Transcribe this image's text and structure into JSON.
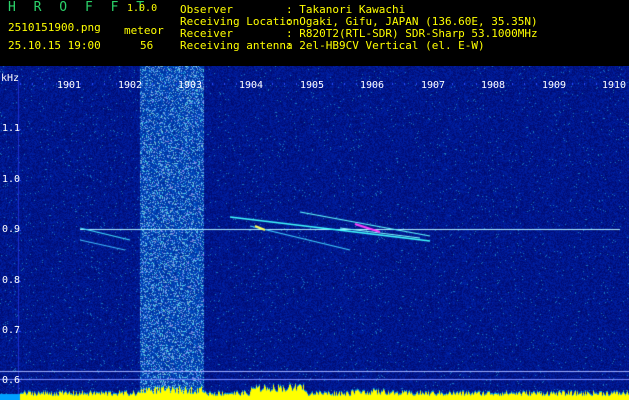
{
  "app": {
    "title": "H R O F F T",
    "version": "1.0.0"
  },
  "file": {
    "name": "2510151900.png",
    "timestamp": "25.10.15 19:00"
  },
  "meteor": {
    "label": "meteor",
    "count": "56"
  },
  "info": [
    {
      "label": "Observer",
      "value": ": Takanori Kawachi"
    },
    {
      "label": "Receiving Location",
      "value": ": Ogaki, Gifu, JAPAN (136.60E, 35.35N)"
    },
    {
      "label": "Receiver",
      "value": ": R820T2(RTL-SDR) SDR-Sharp 53.1000MHz"
    },
    {
      "label": "Receiving antenna",
      "value": ": 2el-HB9CV Vertical (el. E-W)"
    }
  ],
  "axis": {
    "unit": "kHz",
    "x_ticks": [
      "1901",
      "1902",
      "1903",
      "1904",
      "1905",
      "1906",
      "1907",
      "1908",
      "1909",
      "1910"
    ],
    "y_ticks": [
      "1.1",
      "1.0",
      "0.9",
      "0.8",
      "0.7",
      "0.6"
    ]
  },
  "colors": {
    "background": "#06067a",
    "signal": "#00ffff",
    "power": "#ffff00",
    "grid": "#1e3cff"
  }
}
